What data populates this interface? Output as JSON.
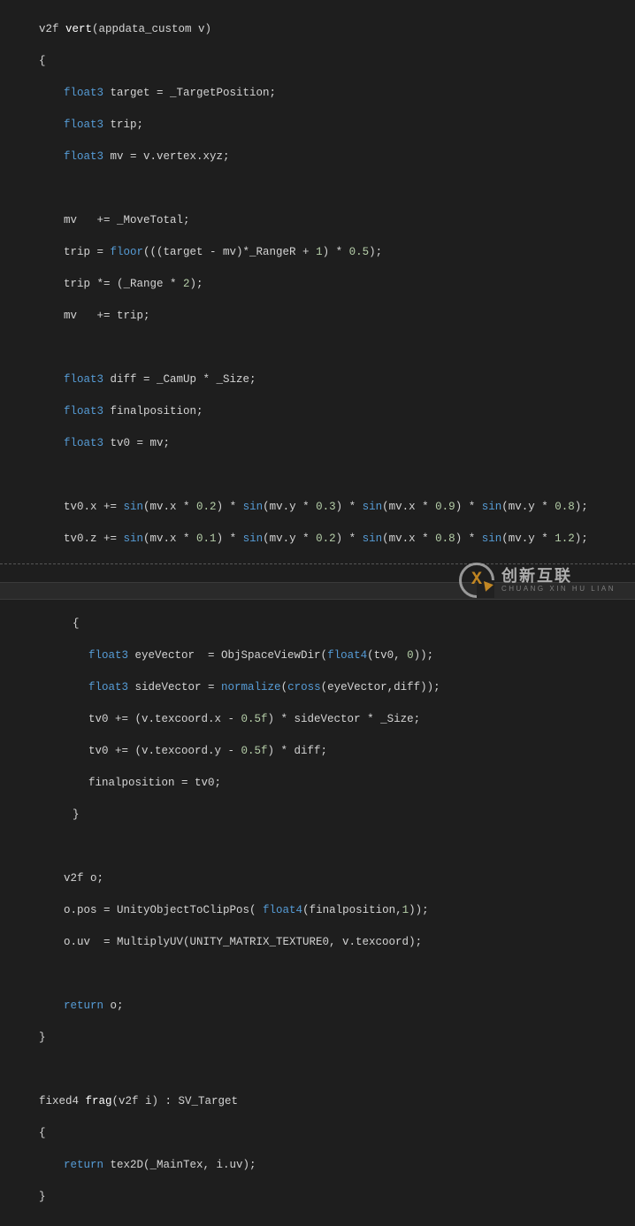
{
  "watermark": {
    "title": "创新互联",
    "subtitle": "CHUANG XIN HU LIAN"
  },
  "code": {
    "l1_a": "v2f ",
    "l1_b": "vert",
    "l1_c": "(appdata_custom v)",
    "l2": "{",
    "l3_a": "float3",
    "l3_b": " target = _TargetPosition;",
    "l4_a": "float3",
    "l4_b": " trip;",
    "l5_a": "float3",
    "l5_b": " mv = v.vertex.xyz;",
    "l7": "mv   += _MoveTotal;",
    "l8_a": "trip = ",
    "l8_b": "floor",
    "l8_c": "(((target - mv)*_RangeR + ",
    "l8_d": "1",
    "l8_e": ") * ",
    "l8_f": "0.5",
    "l8_g": ");",
    "l9_a": "trip *= (_Range * ",
    "l9_b": "2",
    "l9_c": ");",
    "l10": "mv   += trip;",
    "l12_a": "float3",
    "l12_b": " diff = _CamUp * _Size;",
    "l13_a": "float3",
    "l13_b": " finalposition;",
    "l14_a": "float3",
    "l14_b": " tv0 = mv;",
    "l16_a": "tv0.x += ",
    "l16_b": "sin",
    "l16_c": "(mv.x * ",
    "l16_d": "0.2",
    "l16_e": ") * ",
    "l16_f": "sin",
    "l16_g": "(mv.y * ",
    "l16_h": "0.3",
    "l16_i": ") * ",
    "l16_j": "sin",
    "l16_k": "(mv.x * ",
    "l16_l": "0.9",
    "l16_m": ") * ",
    "l16_n": "sin",
    "l16_o": "(mv.y * ",
    "l16_p": "0.8",
    "l16_q": ");",
    "l17_a": "tv0.z += ",
    "l17_d": "0.1",
    "l17_h": "0.2",
    "l17_l": "0.8",
    "l17_p": "1.2",
    "l19": "{",
    "l20_a": "float3",
    "l20_b": " eyeVector  = ObjSpaceViewDir(",
    "l20_c": "float4",
    "l20_d": "(tv0, ",
    "l20_e": "0",
    "l20_f": "));",
    "l21_a": "float3",
    "l21_b": " sideVector = ",
    "l21_c": "normalize",
    "l21_d": "(",
    "l21_e": "cross",
    "l21_f": "(eyeVector,diff));",
    "l22_a": "tv0 += (v.texcoord.x - ",
    "l22_b": "0.5f",
    "l22_c": ") * sideVector * _Size;",
    "l23_a": "tv0 += (v.texcoord.y - ",
    "l23_b": "0.5f",
    "l23_c": ") * diff;",
    "l24": "finalposition = tv0;",
    "l25": "}",
    "l27": "v2f o;",
    "l28_a": "o.pos = UnityObjectToClipPos( ",
    "l28_b": "float4",
    "l28_c": "(finalposition,",
    "l28_d": "1",
    "l28_e": "));",
    "l29": "o.uv  = MultiplyUV(UNITY_MATRIX_TEXTURE0, v.texcoord);",
    "l31_a": "return",
    "l31_b": " o;",
    "l32": "}",
    "l34_a": "fixed4 ",
    "l34_b": "frag",
    "l34_c": "(v2f i) : SV_Target",
    "l35": "{",
    "l36_a": "return",
    "l36_b": " tex2D(_MainTex, i.uv);",
    "l37": "}"
  }
}
